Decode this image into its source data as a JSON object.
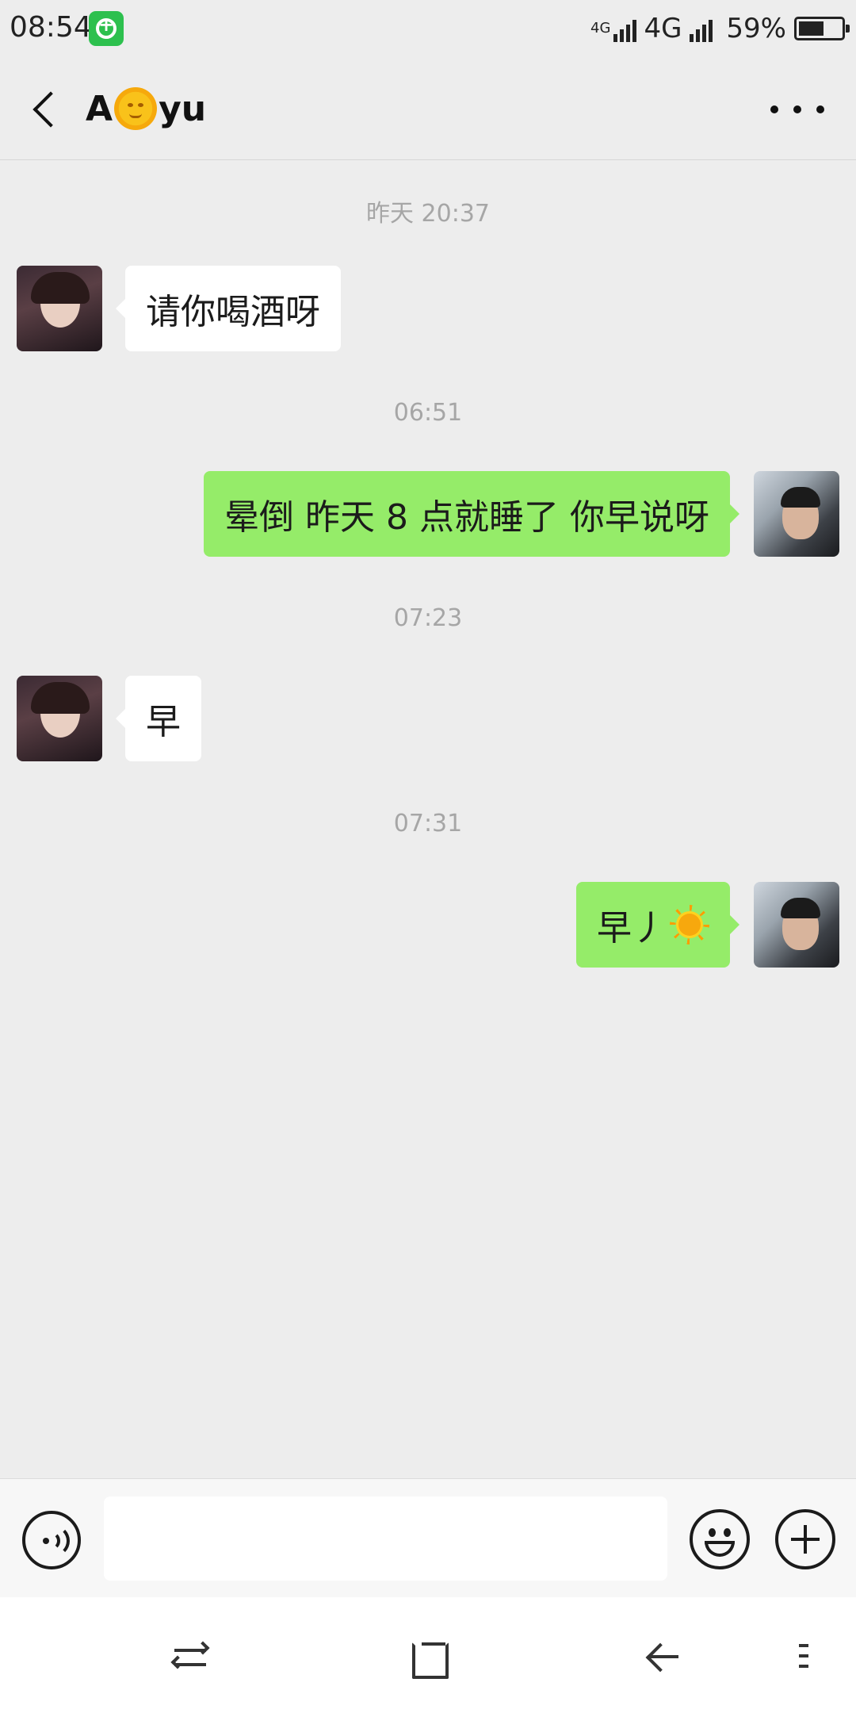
{
  "status_bar": {
    "time": "08:54",
    "network_small": "4G",
    "network_label": "4G",
    "battery_percent": "59%",
    "battery_level": 0.59
  },
  "header": {
    "title_prefix": "A",
    "title_suffix": "yu",
    "title_emoji": "sun-with-face-emoji",
    "back_icon": "chevron-left-icon",
    "more_icon": "more-dots-icon"
  },
  "messages": [
    {
      "timestamp": "昨天 20:37",
      "side": "left",
      "text": "请你喝酒呀"
    },
    {
      "timestamp": "06:51",
      "side": "right",
      "text": "晕倒  昨天 8 点就睡了  你早说呀"
    },
    {
      "timestamp": "07:23",
      "side": "left",
      "text": "早"
    },
    {
      "timestamp": "07:31",
      "side": "right",
      "text": "早丿",
      "emoji": "sun-emoji"
    }
  ],
  "input_bar": {
    "value": "",
    "voice_icon": "voice-icon",
    "emoji_icon": "emoji-smile-icon",
    "plus_icon": "plus-circle-icon"
  },
  "nav_bar": {
    "icons": [
      "switch-icon",
      "home-icon",
      "back-icon",
      "menu-icon"
    ]
  },
  "colors": {
    "background": "#ededed",
    "bubble_self": "#95ec69",
    "bubble_other": "#ffffff",
    "timestamp": "#a6a6a6"
  }
}
